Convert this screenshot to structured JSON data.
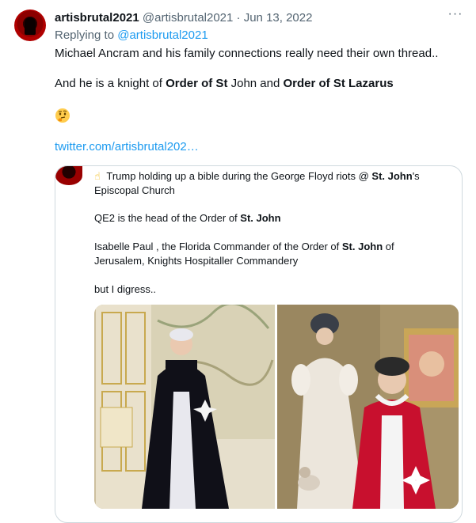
{
  "author": {
    "display_name": "artisbrutal2021",
    "handle": "@artisbrutal2021",
    "separator": "·",
    "date": "Jun 13, 2022"
  },
  "more_label": "···",
  "replying": {
    "prefix": "Replying to ",
    "handle": "@artisbrutal2021"
  },
  "tweet": {
    "line1": "Michael Ancram and his family connections really need their own thread..",
    "line2_part1": "And he is a knight of ",
    "line2_bold1": "Order of St",
    "line2_part2": " John and ",
    "line2_bold2": "Order of St Lazarus",
    "emoji_name": "thinking-face-emoji",
    "link": "twitter.com/artisbrutal202…"
  },
  "quote": {
    "line1_pre": "Trump holding up a bible during the George Floyd riots @ ",
    "line1_bold": "St. John",
    "line1_post": "'s",
    "line1b": "Episcopal Church",
    "line2_pre": "QE2 is the head of the Order of ",
    "line2_bold": "St. John",
    "line3_pre": "Isabelle Paul , the Florida Commander of the Order of ",
    "line3_bold": "St. John",
    "line3_post": " of",
    "line3b": "Jerusalem, Knights Hospitaller Commandery",
    "line4": "but I digress..",
    "hand_emoji": "☝"
  },
  "colors": {
    "link": "#1d9bf0",
    "secondary": "#536471",
    "border": "#cfd9de",
    "cape_red": "#c8102e"
  }
}
